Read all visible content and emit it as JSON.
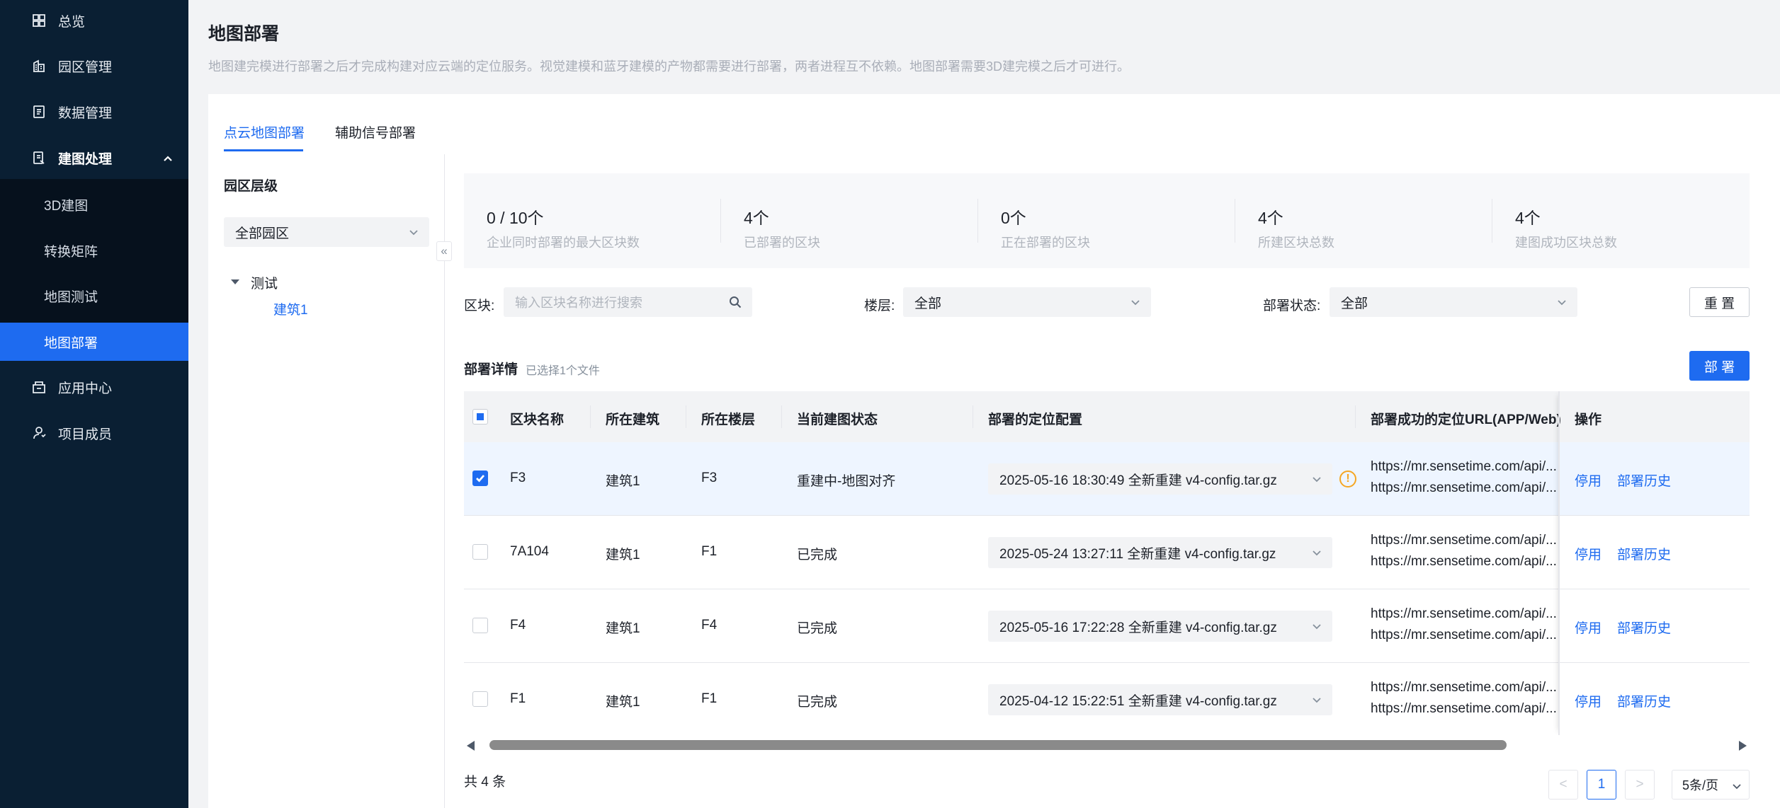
{
  "sidebar": {
    "items": [
      {
        "label": "总览",
        "icon": "grid-icon"
      },
      {
        "label": "园区管理",
        "icon": "building-icon"
      },
      {
        "label": "数据管理",
        "icon": "data-icon"
      },
      {
        "label": "建图处理",
        "icon": "map-process-icon",
        "expanded": true
      },
      {
        "label": "应用中心",
        "icon": "app-center-icon"
      },
      {
        "label": "项目成员",
        "icon": "user-icon"
      }
    ],
    "subitems": [
      "3D建图",
      "转换矩阵",
      "地图测试",
      "地图部署"
    ],
    "active_subitem": "地图部署"
  },
  "header": {
    "title": "地图部署",
    "description": "地图建完模进行部署之后才完成构建对应云端的定位服务。视觉建模和蓝牙建模的产物都需要进行部署，两者进程互不依赖。地图部署需要3D建完模之后才可进行。"
  },
  "tabs": [
    {
      "label": "点云地图部署",
      "active": true
    },
    {
      "label": "辅助信号部署",
      "active": false
    }
  ],
  "tree": {
    "title": "园区层级",
    "select_value": "全部园区",
    "collapse_glyph": "«",
    "root": "测试",
    "child": "建筑1"
  },
  "stats": [
    {
      "value": "0 / 10个",
      "label": "企业同时部署的最大区块数"
    },
    {
      "value": "4个",
      "label": "已部署的区块"
    },
    {
      "value": "0个",
      "label": "正在部署的区块"
    },
    {
      "value": "4个",
      "label": "所建区块总数"
    },
    {
      "value": "4个",
      "label": "建图成功区块总数"
    }
  ],
  "filters": {
    "block_label": "区块:",
    "block_placeholder": "输入区块名称进行搜索",
    "floor_label": "楼层:",
    "floor_value": "全部",
    "status_label": "部署状态:",
    "status_value": "全部",
    "reset_label": "重 置"
  },
  "section": {
    "title": "部署详情",
    "subtitle": "已选择1个文件",
    "deploy_label": "部 署"
  },
  "table": {
    "columns": [
      "区块名称",
      "所在建筑",
      "所在楼层",
      "当前建图状态",
      "部署的定位配置",
      "部署成功的定位URL(APP/Web)",
      "操作"
    ],
    "rows": [
      {
        "block": "F3",
        "building": "建筑1",
        "floor": "F3",
        "status": "重建中-地图对齐",
        "config": "2025-05-16 18:30:49 全新重建 v4-config.tar.gz",
        "url1": "https://mr.sensetime.com/api/...",
        "url2": "https://mr.sensetime.com/api/...",
        "checked": true,
        "warning": true,
        "op1": "停用",
        "op2": "部署历史"
      },
      {
        "block": "7A104",
        "building": "建筑1",
        "floor": "F1",
        "status": "已完成",
        "config": "2025-05-24 13:27:11 全新重建 v4-config.tar.gz",
        "url1": "https://mr.sensetime.com/api/...",
        "url2": "https://mr.sensetime.com/api/...",
        "checked": false,
        "warning": false,
        "op1": "停用",
        "op2": "部署历史"
      },
      {
        "block": "F4",
        "building": "建筑1",
        "floor": "F4",
        "status": "已完成",
        "config": "2025-05-16 17:22:28 全新重建 v4-config.tar.gz",
        "url1": "https://mr.sensetime.com/api/...",
        "url2": "https://mr.sensetime.com/api/...",
        "checked": false,
        "warning": false,
        "op1": "停用",
        "op2": "部署历史"
      },
      {
        "block": "F1",
        "building": "建筑1",
        "floor": "F1",
        "status": "已完成",
        "config": "2025-04-12 15:22:51 全新重建 v4-config.tar.gz",
        "url1": "https://mr.sensetime.com/api/...",
        "url2": "https://mr.sensetime.com/api/...",
        "checked": false,
        "warning": false,
        "op1": "停用",
        "op2": "部署历史"
      }
    ]
  },
  "scroll": {
    "position_fraction": 0.0
  },
  "pagination": {
    "total": "共 4 条",
    "prev": "<",
    "current": "1",
    "next": ">",
    "page_size": "5条/页"
  },
  "colors": {
    "sidebar_bg": "#0a1f33",
    "accent": "#1e6bf0",
    "warning": "#f5a623"
  }
}
